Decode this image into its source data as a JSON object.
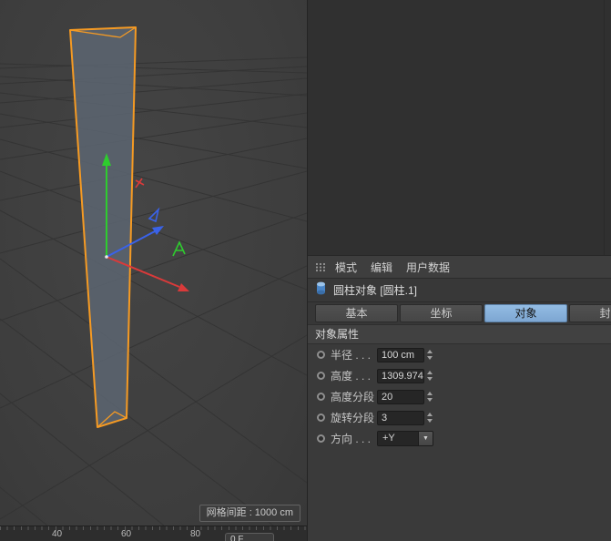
{
  "viewport": {
    "grid_spacing_label": "网格间距 : 1000 cm"
  },
  "timeline": {
    "ticks": [
      "40",
      "60",
      "80"
    ],
    "frame_value": "0 F"
  },
  "attribute_panel": {
    "menu_items": [
      "模式",
      "编辑",
      "用户数据"
    ],
    "object_title": "圆柱对象 [圆柱.1]",
    "tabs": [
      {
        "label": "基本",
        "active": false
      },
      {
        "label": "坐标",
        "active": false
      },
      {
        "label": "对象",
        "active": true
      },
      {
        "label": "封顶",
        "active": false
      }
    ],
    "section_title": "对象属性",
    "fields": [
      {
        "label": "半径 . . .",
        "value": "100 cm",
        "control": "stepper"
      },
      {
        "label": "高度 . . .",
        "value": "1309.974",
        "control": "stepper"
      },
      {
        "label": "高度分段",
        "value": "20",
        "control": "stepper"
      },
      {
        "label": "旋转分段",
        "value": "3",
        "control": "stepper"
      },
      {
        "label": "方向 . . .",
        "value": "+Y",
        "control": "dropdown"
      }
    ]
  },
  "colors": {
    "active_tab": "#7da6d2",
    "selection_orange": "#f59a23",
    "axis_x": "#d93a3a",
    "axis_y": "#2ecc2e",
    "axis_z": "#3a62e8",
    "object_icon_blue": "#4a86c8"
  }
}
